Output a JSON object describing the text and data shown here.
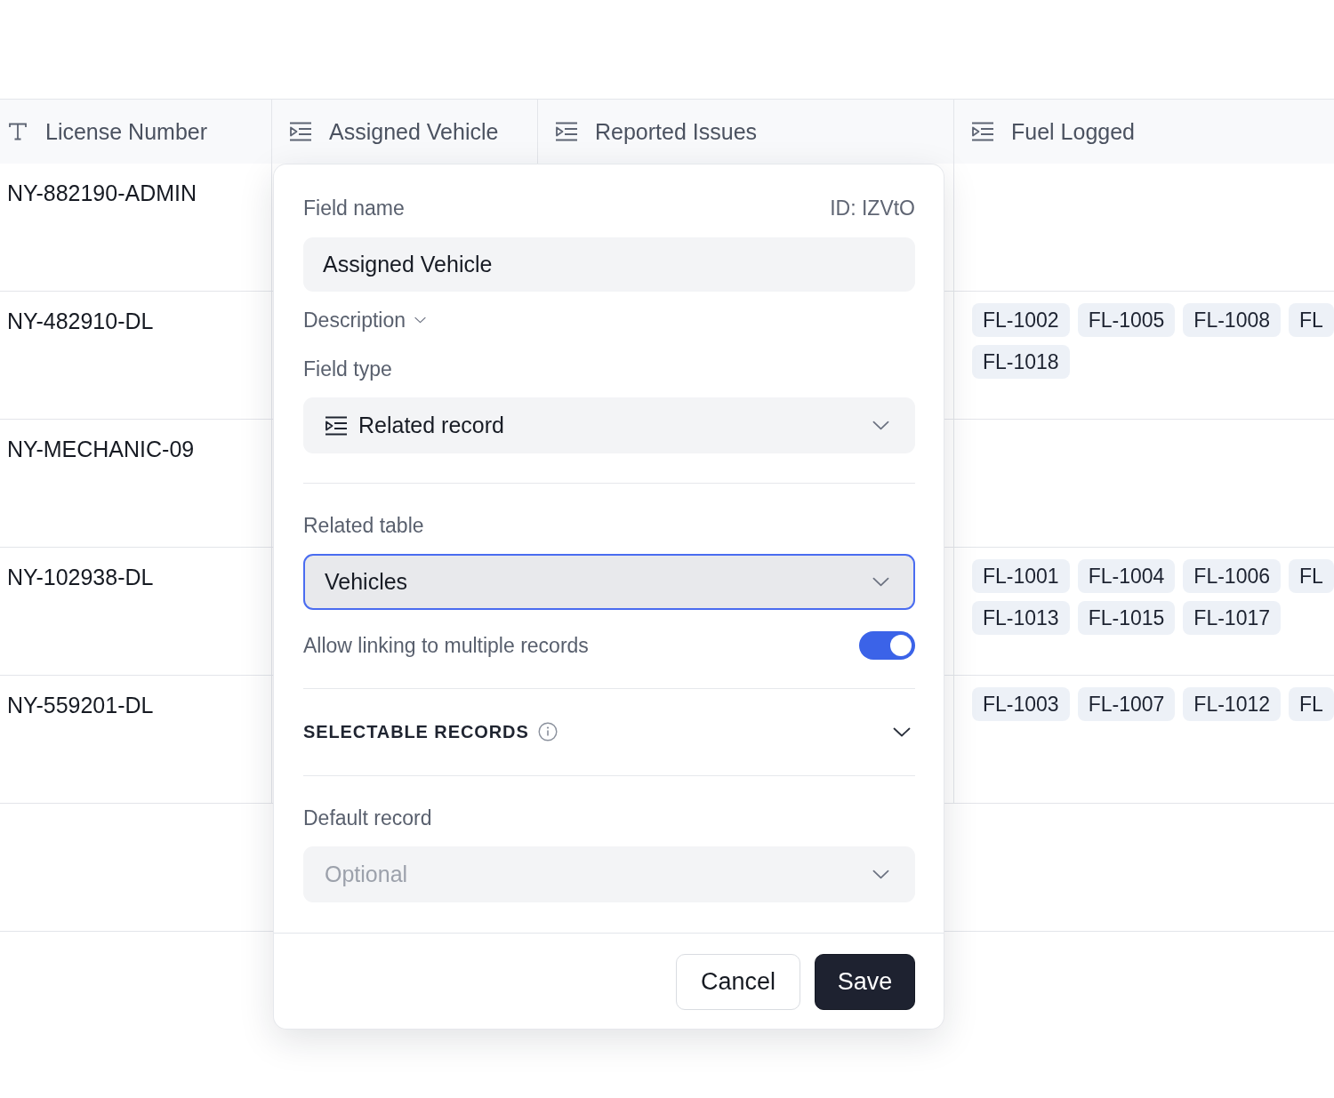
{
  "table": {
    "columns": [
      {
        "label": "License Number",
        "kind": "text"
      },
      {
        "label": "Assigned Vehicle",
        "kind": "relation"
      },
      {
        "label": "Reported Issues",
        "kind": "relation"
      },
      {
        "label": "Fuel Logged",
        "kind": "relation"
      }
    ],
    "rows": [
      {
        "license_number": "NY-882190-ADMIN"
      },
      {
        "license_number": "NY-482910-DL",
        "fuel_logged": [
          [
            "FL-1002",
            "FL-1005",
            "FL-1008",
            "FL"
          ],
          [
            "FL-1018"
          ]
        ]
      },
      {
        "license_number": "NY-MECHANIC-09"
      },
      {
        "license_number": "NY-102938-DL",
        "fuel_logged": [
          [
            "FL-1001",
            "FL-1004",
            "FL-1006",
            "FL"
          ],
          [
            "FL-1013",
            "FL-1015",
            "FL-1017"
          ]
        ]
      },
      {
        "license_number": "NY-559201-DL",
        "fuel_logged": [
          [
            "FL-1003",
            "FL-1007",
            "FL-1012",
            "FL"
          ]
        ]
      }
    ]
  },
  "field_editor": {
    "field_name": {
      "label": "Field name",
      "id": "ID: IZVtO",
      "value": "Assigned Vehicle"
    },
    "description": {
      "label": "Description",
      "expanded": false
    },
    "field_type": {
      "label": "Field type",
      "value": "Related record",
      "kind": "relation"
    },
    "related_table": {
      "label": "Related table",
      "value": "Vehicles",
      "focused": true
    },
    "allow_multiple": {
      "label": "Allow linking to multiple records",
      "on": true
    },
    "selectable_records": {
      "label": "SELECTABLE RECORDS",
      "expanded": false
    },
    "default_record": {
      "label": "Default record",
      "placeholder": "Optional"
    },
    "buttons": [
      {
        "label": "Cancel",
        "kind": "secondary"
      },
      {
        "label": "Save",
        "kind": "primary"
      }
    ]
  }
}
